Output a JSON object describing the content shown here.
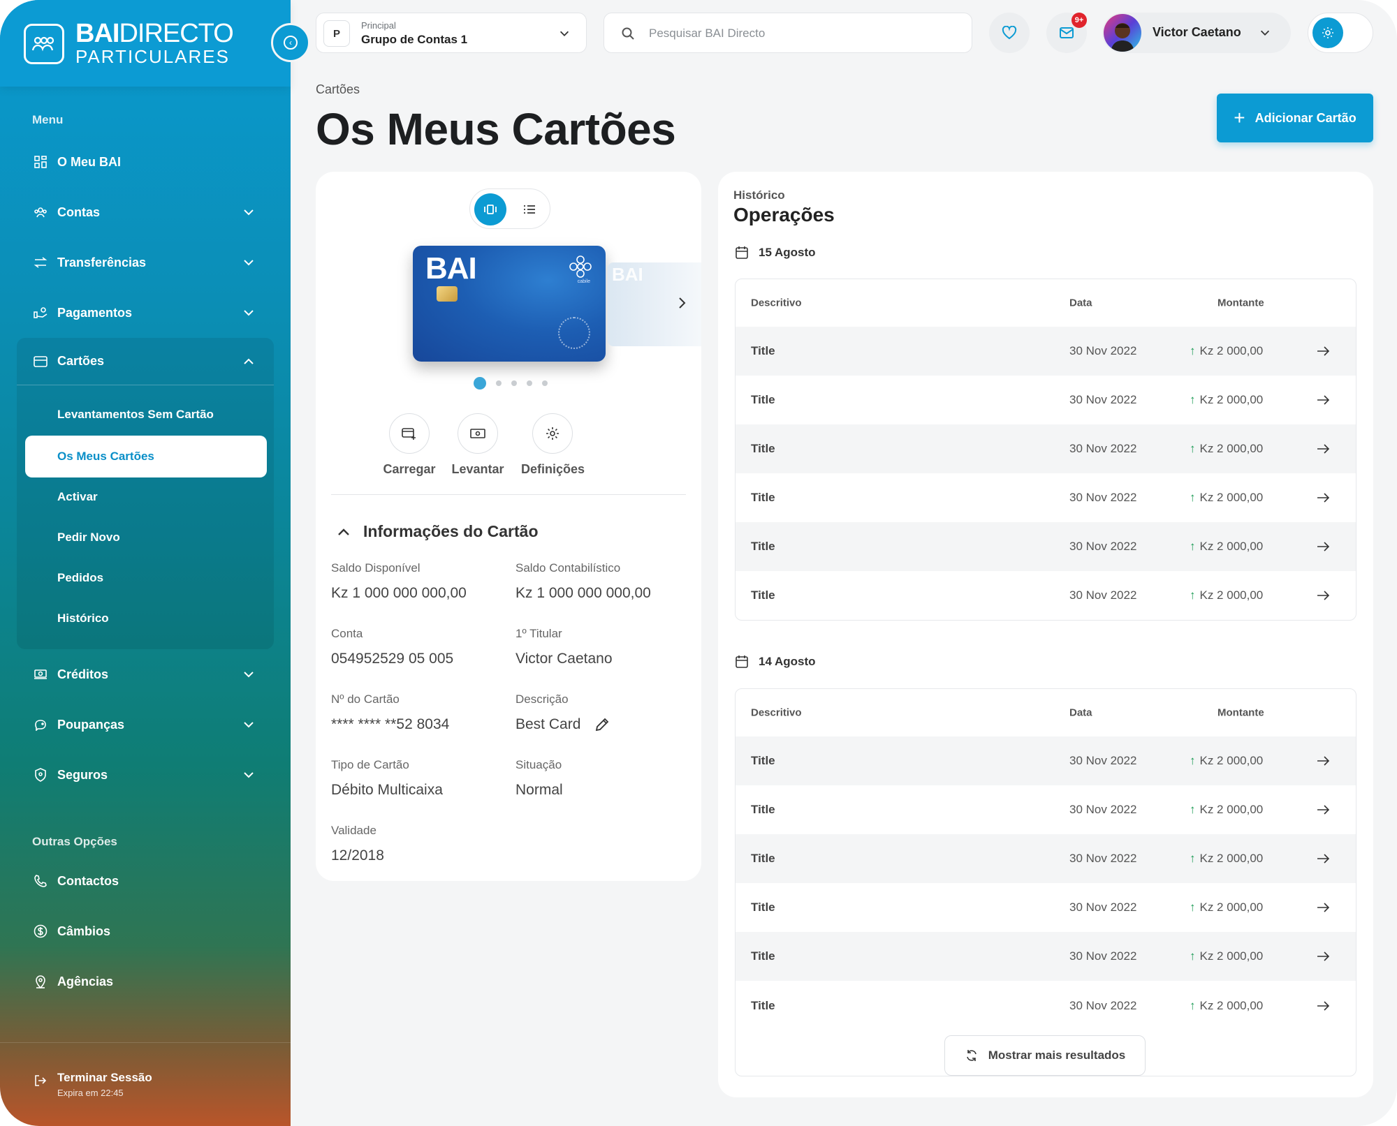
{
  "brand": {
    "name_bold": "BAI",
    "name_rest": "DIRECTO",
    "sub": "PARTICULARES"
  },
  "sidebar": {
    "menu_heading": "Menu",
    "items": [
      {
        "label": "O Meu BAI",
        "icon": "dashboard-icon"
      },
      {
        "label": "Contas",
        "icon": "users-icon"
      },
      {
        "label": "Transferências",
        "icon": "transfer-icon"
      },
      {
        "label": "Pagamentos",
        "icon": "payment-icon"
      },
      {
        "label": "Cartões",
        "icon": "card-icon"
      },
      {
        "label": "Créditos",
        "icon": "credit-icon"
      },
      {
        "label": "Poupanças",
        "icon": "piggy-bank-icon"
      },
      {
        "label": "Seguros",
        "icon": "shield-icon"
      }
    ],
    "cards_submenu": [
      "Levantamentos Sem Cartão",
      "Os Meus Cartões",
      "Activar",
      "Pedir Novo",
      "Pedidos",
      "Histórico"
    ],
    "other_heading": "Outras Opções",
    "other_items": [
      {
        "label": "Contactos",
        "icon": "phone-icon"
      },
      {
        "label": "Câmbios",
        "icon": "currency-icon"
      },
      {
        "label": "Agências",
        "icon": "location-icon"
      }
    ],
    "logout": {
      "label": "Terminar Sessão",
      "expires": "Expira em 22:45"
    }
  },
  "topbar": {
    "account_badge": "P",
    "account_small": "Principal",
    "account_big": "Grupo de Contas 1",
    "search_placeholder": "Pesquisar BAI Directo",
    "notif_count": "9+",
    "user_name": "Victor Caetano"
  },
  "page": {
    "breadcrumb": "Cartões",
    "title": "Os Meus Cartões",
    "add_button": "Adicionar Cartão"
  },
  "card": {
    "brand": "BAI",
    "ghost_brand": "BAI",
    "sub": "cabile",
    "actions": [
      "Carregar",
      "Levantar",
      "Definições"
    ],
    "info_title": "Informações do Cartão",
    "fields": {
      "saldo_disponivel": {
        "label": "Saldo Disponível",
        "value": "Kz 1 000 000 000,00"
      },
      "saldo_contabilistico": {
        "label": "Saldo Contabilístico",
        "value": "Kz 1 000 000 000,00"
      },
      "conta": {
        "label": "Conta",
        "value": "054952529 05 005"
      },
      "titular": {
        "label": "1º Titular",
        "value": "Victor Caetano"
      },
      "numero": {
        "label": "Nº do Cartão",
        "value": "**** **** **52 8034"
      },
      "descricao": {
        "label": "Descrição",
        "value": "Best Card"
      },
      "tipo": {
        "label": "Tipo de Cartão",
        "value": "Débito Multicaixa"
      },
      "situacao": {
        "label": "Situação",
        "value": "Normal"
      },
      "validade": {
        "label": "Validade",
        "value": "12/2018"
      }
    }
  },
  "operations": {
    "small": "Histórico",
    "title": "Operações",
    "columns": {
      "desc": "Descritivo",
      "date": "Data",
      "amount": "Montante"
    },
    "groups": [
      {
        "date": "15 Agosto",
        "rows": [
          {
            "desc": "Title",
            "date": "30 Nov 2022",
            "amount": "Kz 2 000,00"
          },
          {
            "desc": "Title",
            "date": "30 Nov 2022",
            "amount": "Kz 2 000,00"
          },
          {
            "desc": "Title",
            "date": "30 Nov 2022",
            "amount": "Kz 2 000,00"
          },
          {
            "desc": "Title",
            "date": "30 Nov 2022",
            "amount": "Kz 2 000,00"
          },
          {
            "desc": "Title",
            "date": "30 Nov 2022",
            "amount": "Kz 2 000,00"
          },
          {
            "desc": "Title",
            "date": "30 Nov 2022",
            "amount": "Kz 2 000,00"
          }
        ]
      },
      {
        "date": "14 Agosto",
        "rows": [
          {
            "desc": "Title",
            "date": "30 Nov 2022",
            "amount": "Kz 2 000,00"
          },
          {
            "desc": "Title",
            "date": "30 Nov 2022",
            "amount": "Kz 2 000,00"
          },
          {
            "desc": "Title",
            "date": "30 Nov 2022",
            "amount": "Kz 2 000,00"
          },
          {
            "desc": "Title",
            "date": "30 Nov 2022",
            "amount": "Kz 2 000,00"
          },
          {
            "desc": "Title",
            "date": "30 Nov 2022",
            "amount": "Kz 2 000,00"
          },
          {
            "desc": "Title",
            "date": "30 Nov 2022",
            "amount": "Kz 2 000,00"
          }
        ]
      }
    ],
    "more_button": "Mostrar mais resultados"
  },
  "colors": {
    "accent": "#0c9bd3",
    "positive": "#1a9a53",
    "badge": "#e0242c"
  }
}
